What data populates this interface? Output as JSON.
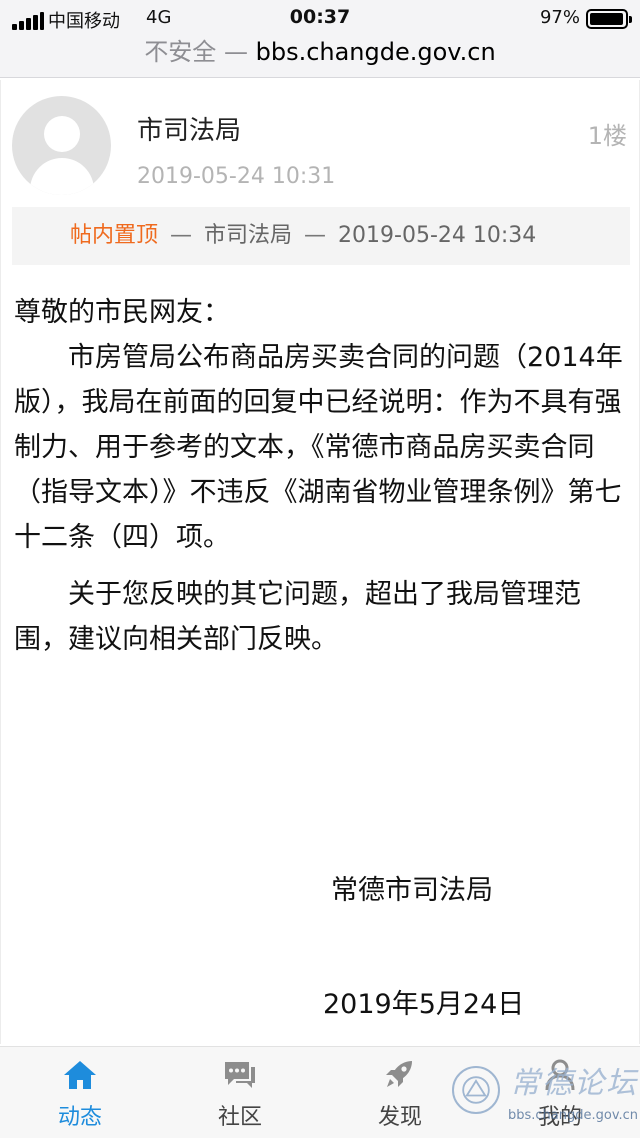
{
  "status_bar": {
    "carrier": "中国移动",
    "network": "4G",
    "time": "00:37",
    "battery_percent": "97%",
    "battery_level": 0.97
  },
  "url_bar": {
    "security": "不安全 —",
    "domain": "bbs.changde.gov.cn"
  },
  "post": {
    "author": "市司法局",
    "floor": "1楼",
    "time": "2019-05-24 10:31",
    "sticky": {
      "tag": "帖内置顶",
      "separator": "—",
      "by": "市司法局",
      "time": "2019-05-24 10:34"
    },
    "greeting": "尊敬的市民网友：",
    "paragraphs": [
      "市房管局公布商品房买卖合同的问题（2014年版），我局在前面的回复中已经说明：作为不具有强制力、用于参考的文本，《常德市商品房买卖合同（指导文本）》不违反《湖南省物业管理条例》第七十二条（四）项。",
      "关于您反映的其它问题，超出了我局管理范围，建议向相关部门反映。"
    ],
    "signature": "常德市司法局",
    "signature_date": "2019年5月24日"
  },
  "tab_bar": {
    "items": [
      {
        "label": "动态",
        "icon": "home-icon",
        "active": true
      },
      {
        "label": "社区",
        "icon": "chat-icon",
        "active": false
      },
      {
        "label": "发现",
        "icon": "rocket-icon",
        "active": false
      },
      {
        "label": "我的",
        "icon": "person-icon",
        "active": false
      }
    ],
    "active_color": "#1e8cdc"
  },
  "watermark": {
    "title": "常德论坛",
    "url": "bbs.changde.gov.cn"
  },
  "colors": {
    "accent": "#1e8cdc",
    "sticky_tag": "#ef6a1e",
    "muted_text": "#b4b4b4"
  }
}
